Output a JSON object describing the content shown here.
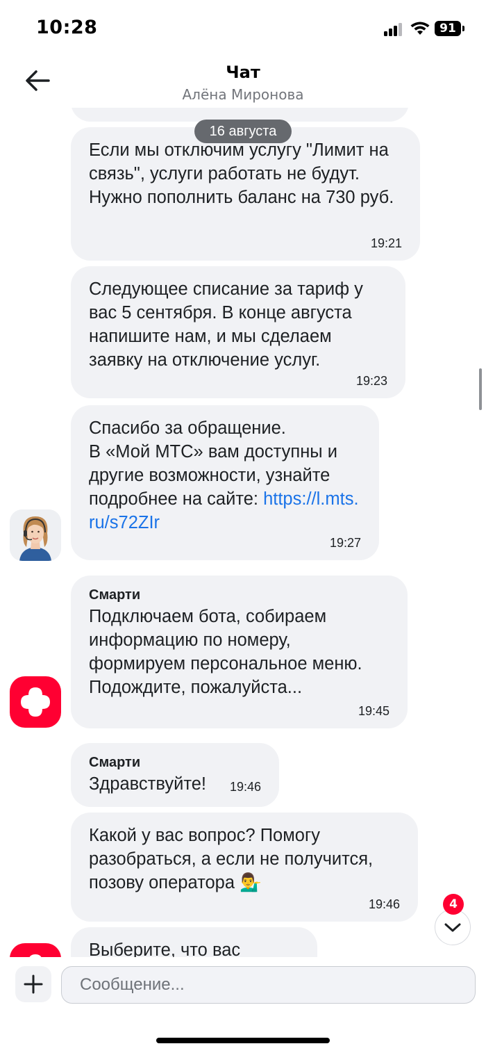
{
  "status_bar": {
    "time": "10:28",
    "battery": "91"
  },
  "header": {
    "title": "Чат",
    "subtitle": "Алёна Миронова"
  },
  "date_separator": "16 августа",
  "messages": [
    {
      "text": "Если мы отключим услугу \"Лимит на связь\", услуги работать не будут. Нужно пополнить баланс на 730 руб.",
      "time": "19:21"
    },
    {
      "text": "Следующее списание за тариф у вас 5 сентября. В конце августа напишите нам, и мы сделаем заявку на отключение услуг.",
      "time": "19:23"
    },
    {
      "text": "Спасибо за обращение.\nВ «Мой МТС» вам доступны и другие возможности, узнайте подробнее на сайте: ",
      "link": "https://l.mts.ru/s72ZIr",
      "time": "19:27"
    },
    {
      "sender": "Смарти",
      "text": "Подключаем бота, собираем информацию по номеру, формируем персональное меню. Подождите, пожалуйста...",
      "time": "19:45"
    },
    {
      "sender": "Смарти",
      "text": "Здравствуйте!",
      "time": "19:46"
    },
    {
      "text": "Какой у вас вопрос? Помогу разобраться, а если не получится, позову оператора 💁‍♂️",
      "time": "19:46"
    },
    {
      "text": "Выберите, что вас"
    }
  ],
  "scroll_down": {
    "unread_count": "4"
  },
  "composer": {
    "placeholder": "Сообщение..."
  },
  "icons": {
    "back": "arrow-left-icon",
    "attach": "plus-icon",
    "scroll_down": "chevron-down-icon",
    "bot": "mts-smarti-logo-icon"
  },
  "colors": {
    "accent": "#ff0032",
    "bubble": "#f1f2f5",
    "link": "#1a73e8"
  }
}
